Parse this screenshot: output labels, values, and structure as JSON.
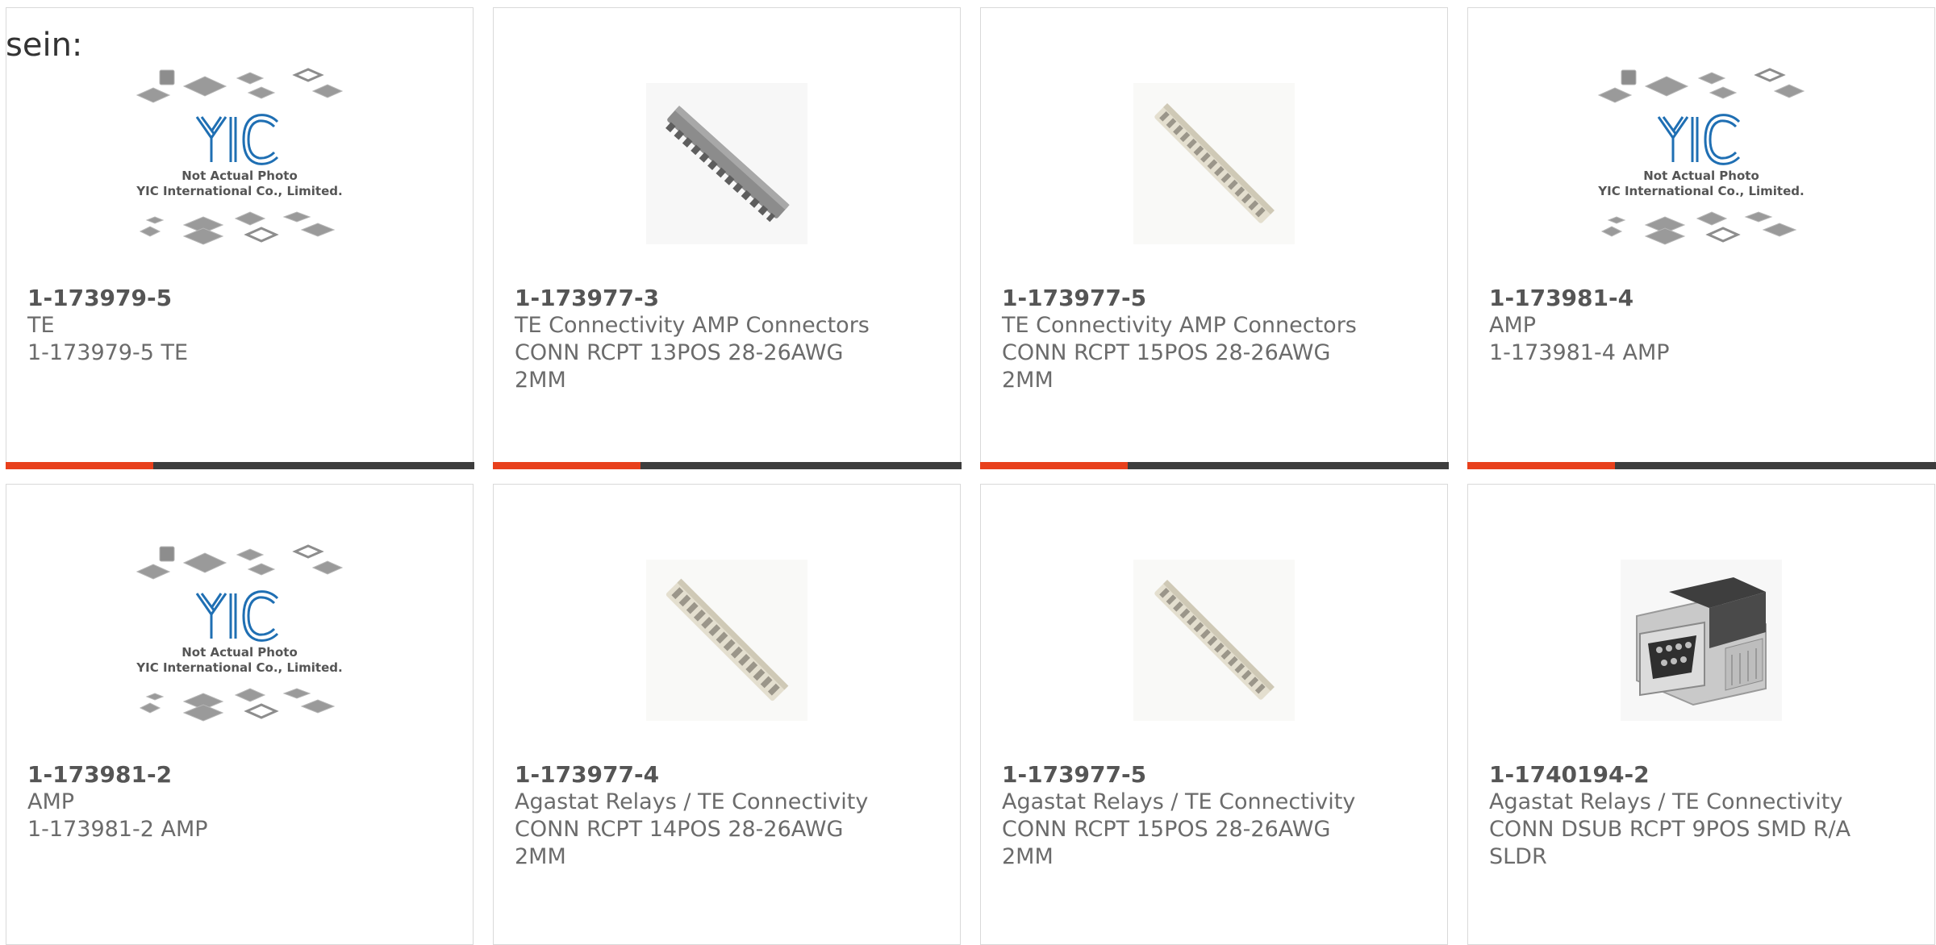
{
  "prefix_text": "sein:",
  "placeholder_text": {
    "line1": "Not Actual Photo",
    "line2": "YIC International Co., Limited.",
    "logo": "YIC"
  },
  "colors": {
    "accent": "#e8401c",
    "bar": "#3d3d3d",
    "text": "#666666",
    "logo_blue": "#1f6fb3"
  },
  "products": [
    {
      "part": "1-173979-5",
      "line1": "TE",
      "line2": "1-173979-5 TE",
      "line3": "",
      "image": "yic-placeholder-icon"
    },
    {
      "part": "1-173977-3",
      "line1": "TE Connectivity AMP Connectors",
      "line2": "CONN RCPT 13POS 28-26AWG",
      "line3": "2MM",
      "image": "connector-strip-gray-icon"
    },
    {
      "part": "1-173977-5",
      "line1": "TE Connectivity AMP Connectors",
      "line2": "CONN RCPT 15POS 28-26AWG",
      "line3": "2MM",
      "image": "connector-strip-beige-icon"
    },
    {
      "part": "1-173981-4",
      "line1": "AMP",
      "line2": "1-173981-4 AMP",
      "line3": "",
      "image": "yic-placeholder-icon"
    },
    {
      "part": "1-173981-2",
      "line1": "AMP",
      "line2": "1-173981-2 AMP",
      "line3": "",
      "image": "yic-placeholder-icon"
    },
    {
      "part": "1-173977-4",
      "line1": "Agastat Relays / TE Connectivity",
      "line2": "CONN RCPT 14POS 28-26AWG",
      "line3": "2MM",
      "image": "connector-strip-beige-icon"
    },
    {
      "part": "1-173977-5",
      "line1": "Agastat Relays / TE Connectivity",
      "line2": "CONN RCPT 15POS 28-26AWG",
      "line3": "2MM",
      "image": "connector-strip-beige-icon"
    },
    {
      "part": "1-1740194-2",
      "line1": "Agastat Relays / TE Connectivity",
      "line2": "CONN DSUB RCPT 9POS SMD R/A",
      "line3": "SLDR",
      "image": "dsub-connector-icon"
    }
  ]
}
